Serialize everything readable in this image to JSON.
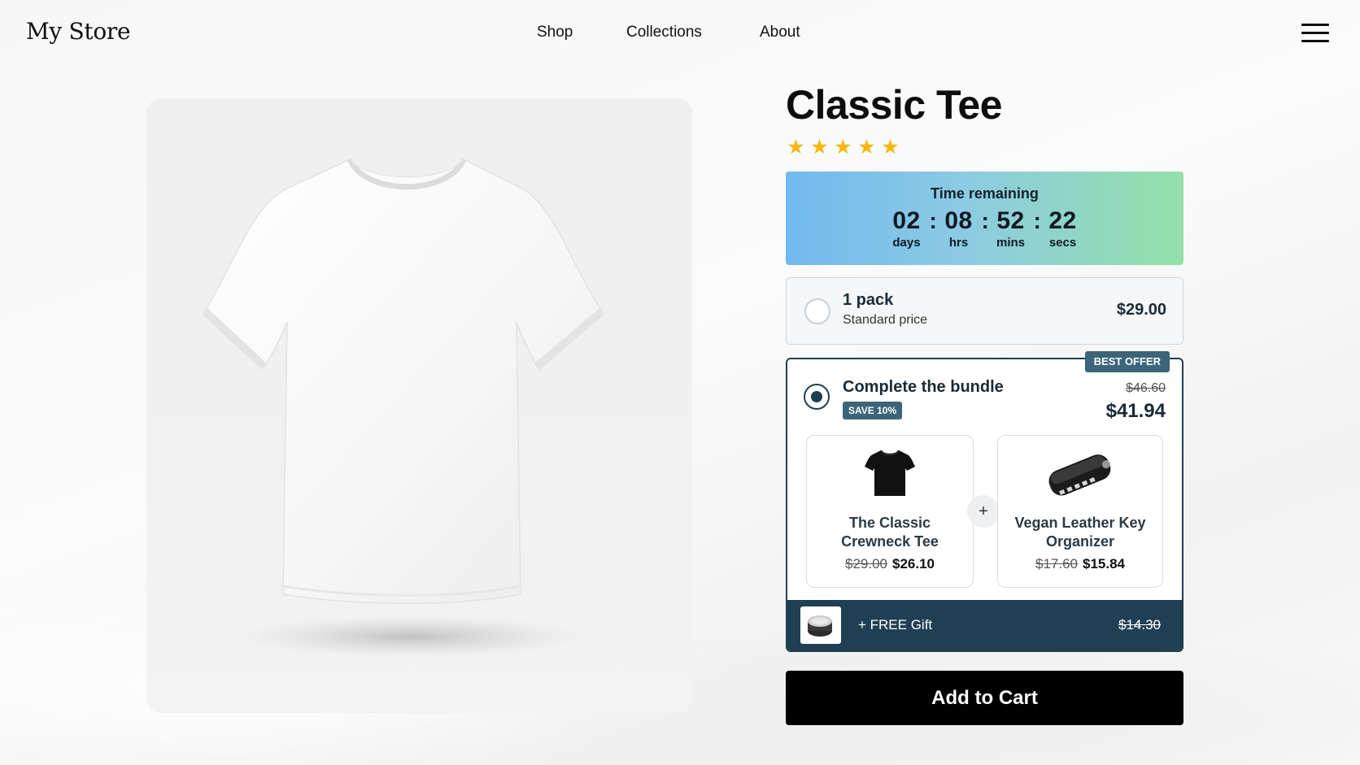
{
  "header": {
    "logo": "My Store",
    "nav": [
      "Shop",
      "Collections",
      "About"
    ]
  },
  "product": {
    "title": "Classic Tee",
    "rating": 5,
    "stars": [
      "★",
      "★",
      "★",
      "★",
      "★"
    ]
  },
  "timer": {
    "label": "Time remaining",
    "units": [
      {
        "value": "02",
        "label": "days"
      },
      {
        "value": "08",
        "label": "hrs"
      },
      {
        "value": "52",
        "label": "mins"
      },
      {
        "value": "22",
        "label": "secs"
      }
    ],
    "separator": ":"
  },
  "option_single": {
    "title": "1 pack",
    "subtitle": "Standard price",
    "price": "$29.00",
    "selected": false
  },
  "option_bundle": {
    "badge": "BEST OFFER",
    "title": "Complete the bundle",
    "save_badge": "SAVE 10%",
    "old_price": "$46.60",
    "price": "$41.94",
    "selected": true,
    "plus": "+",
    "items": [
      {
        "name": "The Classic Crewneck Tee",
        "old_price": "$29.00",
        "price": "$26.10",
        "icon": "black-tshirt-icon"
      },
      {
        "name": "Vegan Leather Key Organizer",
        "old_price": "$17.60",
        "price": "$15.84",
        "icon": "key-organizer-icon"
      }
    ],
    "gift": {
      "label": "+ FREE Gift",
      "price": "$14.30",
      "icon": "gift-tin-icon"
    }
  },
  "cta": {
    "label": "Add to Cart"
  },
  "colors": {
    "star": "#f5b70a",
    "accent_dark": "#1f4052",
    "badge": "#3c6579",
    "timer_gradient_start": "#72b9ef",
    "timer_gradient_end": "#93e1a8",
    "cta_bg": "#000000"
  }
}
